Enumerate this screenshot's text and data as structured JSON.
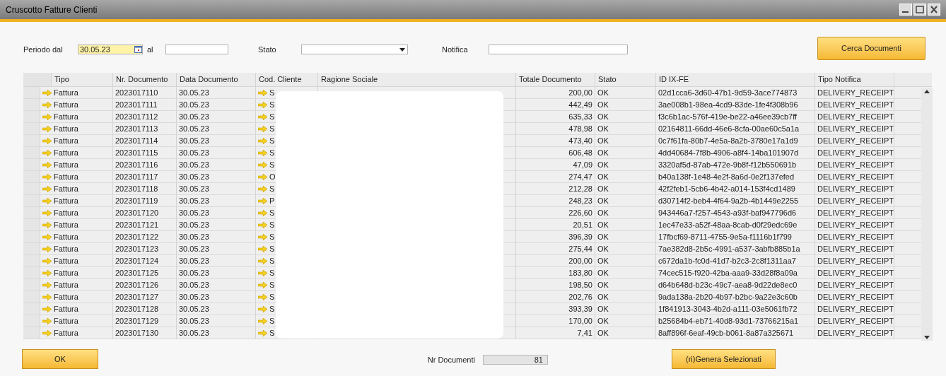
{
  "window": {
    "title": "Cruscotto Fatture Clienti"
  },
  "filters": {
    "period_from_label": "Periodo dal",
    "period_from": "30.05.23",
    "period_to_label": "al",
    "status_label": "Stato",
    "notification_label": "Notifica"
  },
  "search_button": "Cerca Documenti",
  "table": {
    "columns": [
      "Tipo",
      "Nr. Documento",
      "Data Documento",
      "Cod. Cliente",
      "Ragione Sociale",
      "Totale Documento",
      "Stato",
      "ID IX-FE",
      "Tipo Notifica"
    ],
    "rows": [
      {
        "tipo": "Fattura",
        "nr": "2023017110",
        "data": "30.05.23",
        "cod": "S",
        "totale": "200,00",
        "stato": "OK",
        "id": "02d1cca6-3d60-47b1-9d59-3ace774873",
        "notifica": "DELIVERY_RECEIPT"
      },
      {
        "tipo": "Fattura",
        "nr": "2023017111",
        "data": "30.05.23",
        "cod": "S",
        "totale": "442,49",
        "stato": "OK",
        "id": "3ae008b1-98ea-4cd9-83de-1fe4f308b96",
        "notifica": "DELIVERY_RECEIPT"
      },
      {
        "tipo": "Fattura",
        "nr": "2023017112",
        "data": "30.05.23",
        "cod": "S",
        "totale": "635,33",
        "stato": "OK",
        "id": "f3c6b1ac-576f-419e-be22-a46ee39cb7ff",
        "notifica": "DELIVERY_RECEIPT"
      },
      {
        "tipo": "Fattura",
        "nr": "2023017113",
        "data": "30.05.23",
        "cod": "S",
        "totale": "478,98",
        "stato": "OK",
        "id": "02164811-66dd-46e6-8cfa-00ae60c5a1a",
        "notifica": "DELIVERY_RECEIPT"
      },
      {
        "tipo": "Fattura",
        "nr": "2023017114",
        "data": "30.05.23",
        "cod": "S",
        "totale": "473,40",
        "stato": "OK",
        "id": "0c7f61fa-80b7-4e5a-8a2b-3780e17a1d9",
        "notifica": "DELIVERY_RECEIPT"
      },
      {
        "tipo": "Fattura",
        "nr": "2023017115",
        "data": "30.05.23",
        "cod": "S",
        "totale": "606,48",
        "stato": "OK",
        "id": "4dd40684-7f8b-4906-a8f4-14ba101907d",
        "notifica": "DELIVERY_RECEIPT"
      },
      {
        "tipo": "Fattura",
        "nr": "2023017116",
        "data": "30.05.23",
        "cod": "S",
        "totale": "47,09",
        "stato": "OK",
        "id": "3320af5d-87ab-472e-9b8f-f12b550691b",
        "notifica": "DELIVERY_RECEIPT"
      },
      {
        "tipo": "Fattura",
        "nr": "2023017117",
        "data": "30.05.23",
        "cod": "O",
        "totale": "274,47",
        "stato": "OK",
        "id": "b40a138f-1e48-4e2f-8a6d-0e2f137efed",
        "notifica": "DELIVERY_RECEIPT"
      },
      {
        "tipo": "Fattura",
        "nr": "2023017118",
        "data": "30.05.23",
        "cod": "S",
        "totale": "212,28",
        "stato": "OK",
        "id": "42f2feb1-5cb6-4b42-a014-153f4cd1489",
        "notifica": "DELIVERY_RECEIPT"
      },
      {
        "tipo": "Fattura",
        "nr": "2023017119",
        "data": "30.05.23",
        "cod": "P",
        "totale": "248,23",
        "stato": "OK",
        "id": "d30714f2-beb4-4f64-9a2b-4b1449e2255",
        "notifica": "DELIVERY_RECEIPT"
      },
      {
        "tipo": "Fattura",
        "nr": "2023017120",
        "data": "30.05.23",
        "cod": "S",
        "totale": "226,60",
        "stato": "OK",
        "id": "943446a7-f257-4543-a93f-baf947796d6",
        "notifica": "DELIVERY_RECEIPT"
      },
      {
        "tipo": "Fattura",
        "nr": "2023017121",
        "data": "30.05.23",
        "cod": "S",
        "totale": "20,51",
        "stato": "OK",
        "id": "1ec47e33-a52f-48aa-8cab-d0f29edc69e",
        "notifica": "DELIVERY_RECEIPT"
      },
      {
        "tipo": "Fattura",
        "nr": "2023017122",
        "data": "30.05.23",
        "cod": "S",
        "totale": "396,39",
        "stato": "OK",
        "id": "17fbcf69-8711-4755-9e5a-f1116b1f799",
        "notifica": "DELIVERY_RECEIPT"
      },
      {
        "tipo": "Fattura",
        "nr": "2023017123",
        "data": "30.05.23",
        "cod": "S",
        "totale": "275,44",
        "stato": "OK",
        "id": "7ae382d8-2b5c-4991-a537-3abfb885b1a",
        "notifica": "DELIVERY_RECEIPT"
      },
      {
        "tipo": "Fattura",
        "nr": "2023017124",
        "data": "30.05.23",
        "cod": "S",
        "totale": "200,00",
        "stato": "OK",
        "id": "c672da1b-fc0d-41d7-b2c3-2c8f1311aa7",
        "notifica": "DELIVERY_RECEIPT"
      },
      {
        "tipo": "Fattura",
        "nr": "2023017125",
        "data": "30.05.23",
        "cod": "S",
        "totale": "183,80",
        "stato": "OK",
        "id": "74cec515-f920-42ba-aaa9-33d28f8a09a",
        "notifica": "DELIVERY_RECEIPT"
      },
      {
        "tipo": "Fattura",
        "nr": "2023017126",
        "data": "30.05.23",
        "cod": "S",
        "totale": "198,50",
        "stato": "OK",
        "id": "d64b648d-b23c-49c7-aea8-9d22de8ec0",
        "notifica": "DELIVERY_RECEIPT"
      },
      {
        "tipo": "Fattura",
        "nr": "2023017127",
        "data": "30.05.23",
        "cod": "S",
        "totale": "202,76",
        "stato": "OK",
        "id": "9ada138a-2b20-4b97-b2bc-9a22e3c60b",
        "notifica": "DELIVERY_RECEIPT"
      },
      {
        "tipo": "Fattura",
        "nr": "2023017128",
        "data": "30.05.23",
        "cod": "S",
        "totale": "393,39",
        "stato": "OK",
        "id": "1f841913-3043-4b2d-a111-03e5061fb72",
        "notifica": "DELIVERY_RECEIPT"
      },
      {
        "tipo": "Fattura",
        "nr": "2023017129",
        "data": "30.05.23",
        "cod": "S",
        "totale": "170,00",
        "stato": "OK",
        "id": "b25684b4-eb71-40d8-93d1-73766215a1",
        "notifica": "DELIVERY_RECEIPT"
      },
      {
        "tipo": "Fattura",
        "nr": "2023017130",
        "data": "30.05.23",
        "cod": "S",
        "totale": "7,41",
        "stato": "OK",
        "id": "8aff896f-6eaf-49cb-b061-8a87a325671",
        "notifica": "DELIVERY_RECEIPT"
      }
    ]
  },
  "footer": {
    "ok_button": "OK",
    "count_label": "Nr Documenti",
    "count": "81",
    "generate_button": "(ri)Genera Selezionati"
  }
}
